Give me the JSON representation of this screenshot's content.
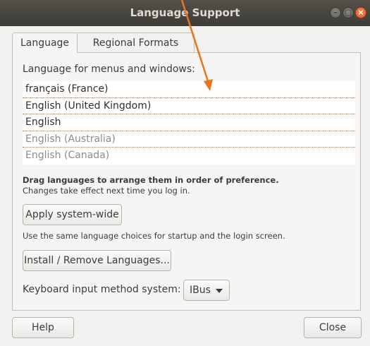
{
  "window": {
    "title": "Language Support"
  },
  "tabs": [
    {
      "label": "Language",
      "active": true
    },
    {
      "label": "Regional Formats",
      "active": false
    }
  ],
  "language_section": {
    "label": "Language for menus and windows:",
    "languages": [
      {
        "name": "français (France)",
        "enabled": true
      },
      {
        "name": "English (United Kingdom)",
        "enabled": true
      },
      {
        "name": "English",
        "enabled": true
      },
      {
        "name": "English (Australia)",
        "enabled": false
      },
      {
        "name": "English (Canada)",
        "enabled": false
      }
    ],
    "hint_bold": "Drag languages to arrange them in order of preference.",
    "hint": "Changes take effect next time you log in."
  },
  "apply_button": "Apply system-wide",
  "apply_hint": "Use the same language choices for startup and the login screen.",
  "install_button": "Install / Remove Languages...",
  "input_method": {
    "label": "Keyboard input method system:",
    "value": "IBus"
  },
  "footer": {
    "help": "Help",
    "close": "Close"
  },
  "colors": {
    "annotation_arrow": "#e8761e",
    "close_button": "#e35a25"
  }
}
